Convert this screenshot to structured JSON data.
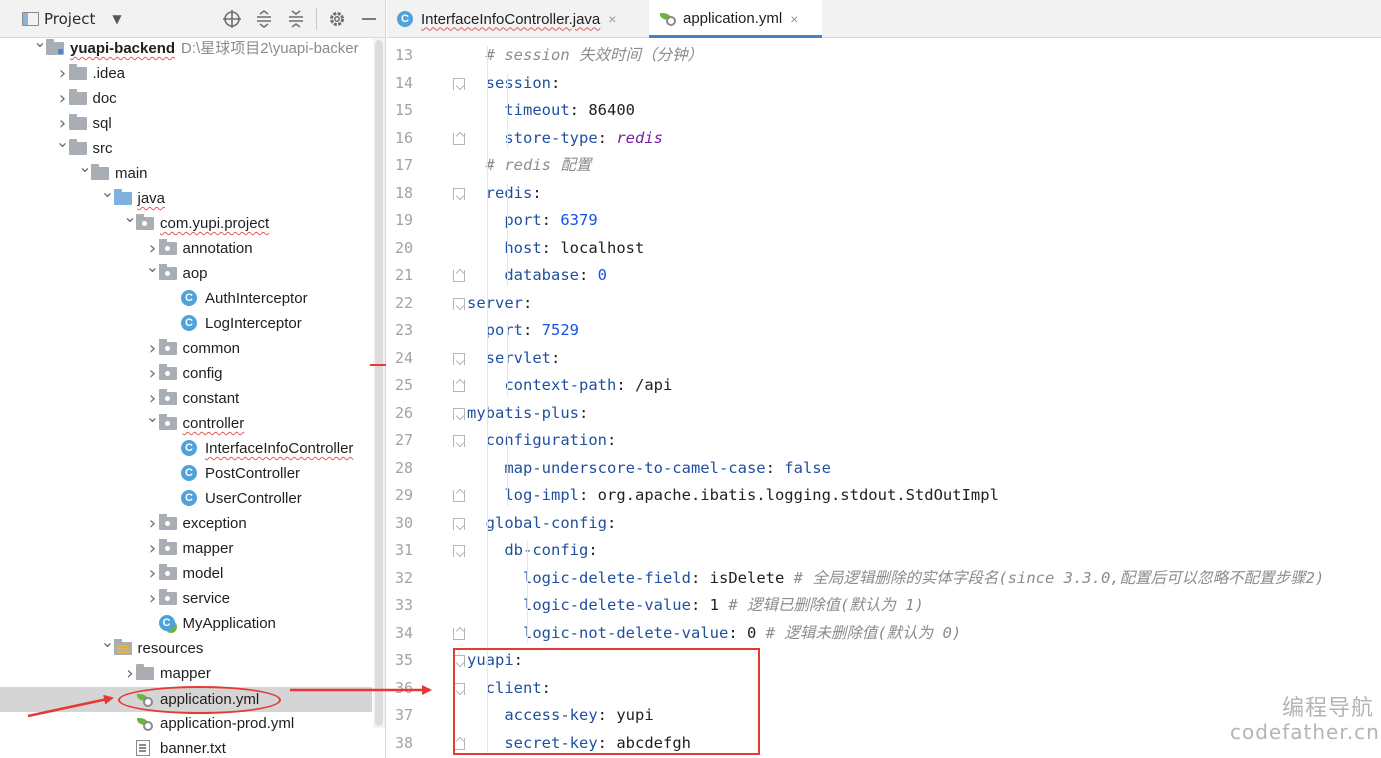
{
  "project_panel": {
    "title": "Project",
    "tree": [
      {
        "label": "yuapi-backend",
        "path": "D:\\星球项目2\\yuapi-backer",
        "icon": "module-folder-icon",
        "arrow": "down",
        "squiggle": true,
        "bold": true
      },
      {
        "label": ".idea",
        "icon": "folder-icon",
        "arrow": "right"
      },
      {
        "label": "doc",
        "icon": "folder-icon",
        "arrow": "right"
      },
      {
        "label": "sql",
        "icon": "folder-icon",
        "arrow": "right"
      },
      {
        "label": "src",
        "icon": "folder-icon",
        "arrow": "down"
      },
      {
        "label": "main",
        "icon": "folder-icon",
        "arrow": "down"
      },
      {
        "label": "java",
        "icon": "source-folder-icon",
        "arrow": "down",
        "squiggle": true
      },
      {
        "label": "com.yupi.project",
        "icon": "package-icon",
        "arrow": "down",
        "squiggle": true
      },
      {
        "label": "annotation",
        "icon": "package-icon",
        "arrow": "right"
      },
      {
        "label": "aop",
        "icon": "package-icon",
        "arrow": "down"
      },
      {
        "label": "AuthInterceptor",
        "icon": "class-icon",
        "arrow": ""
      },
      {
        "label": "LogInterceptor",
        "icon": "class-icon",
        "arrow": ""
      },
      {
        "label": "common",
        "icon": "package-icon",
        "arrow": "right"
      },
      {
        "label": "config",
        "icon": "package-icon",
        "arrow": "right"
      },
      {
        "label": "constant",
        "icon": "package-icon",
        "arrow": "right"
      },
      {
        "label": "controller",
        "icon": "package-icon",
        "arrow": "down",
        "squiggle": true
      },
      {
        "label": "InterfaceInfoController",
        "icon": "class-icon",
        "arrow": "",
        "squiggle": true
      },
      {
        "label": "PostController",
        "icon": "class-icon",
        "arrow": ""
      },
      {
        "label": "UserController",
        "icon": "class-icon",
        "arrow": ""
      },
      {
        "label": "exception",
        "icon": "package-icon",
        "arrow": "right"
      },
      {
        "label": "mapper",
        "icon": "package-icon",
        "arrow": "right"
      },
      {
        "label": "model",
        "icon": "package-icon",
        "arrow": "right"
      },
      {
        "label": "service",
        "icon": "package-icon",
        "arrow": "right"
      },
      {
        "label": "MyApplication",
        "icon": "spring-app-icon",
        "arrow": ""
      },
      {
        "label": "resources",
        "icon": "resources-folder-icon",
        "arrow": "down"
      },
      {
        "label": "mapper",
        "icon": "folder-icon",
        "arrow": "right"
      },
      {
        "label": "application.yml",
        "icon": "spring-yaml-icon",
        "arrow": "",
        "selected": true
      },
      {
        "label": "application-prod.yml",
        "icon": "spring-yaml-icon",
        "arrow": ""
      },
      {
        "label": "banner.txt",
        "icon": "text-file-icon",
        "arrow": ""
      }
    ]
  },
  "editor": {
    "tabs": [
      {
        "label": "InterfaceInfoController.java",
        "icon": "class-icon",
        "active": false,
        "close": "×"
      },
      {
        "label": "application.yml",
        "icon": "spring-yaml-icon",
        "active": true,
        "close": "×"
      }
    ],
    "lines": [
      {
        "no": "13",
        "fold": "",
        "tokens": [
          {
            "t": "  "
          },
          {
            "t": "# session 失效时间（分钟）",
            "c": "comment"
          }
        ]
      },
      {
        "no": "14",
        "fold": "open",
        "tokens": [
          {
            "t": "  "
          },
          {
            "t": "session",
            "c": "key"
          },
          {
            "t": ":"
          }
        ]
      },
      {
        "no": "15",
        "fold": "",
        "tokens": [
          {
            "t": "    "
          },
          {
            "t": "timeout",
            "c": "key"
          },
          {
            "t": ": "
          },
          {
            "t": "86400",
            "c": "str"
          }
        ]
      },
      {
        "no": "16",
        "fold": "close",
        "tokens": [
          {
            "t": "    "
          },
          {
            "t": "store-type",
            "c": "key"
          },
          {
            "t": ": "
          },
          {
            "t": "redis",
            "c": "italic"
          }
        ]
      },
      {
        "no": "17",
        "fold": "",
        "tokens": [
          {
            "t": "  "
          },
          {
            "t": "# redis 配置",
            "c": "comment"
          }
        ]
      },
      {
        "no": "18",
        "fold": "open",
        "tokens": [
          {
            "t": "  "
          },
          {
            "t": "redis",
            "c": "key"
          },
          {
            "t": ":"
          }
        ]
      },
      {
        "no": "19",
        "fold": "",
        "tokens": [
          {
            "t": "    "
          },
          {
            "t": "port",
            "c": "key"
          },
          {
            "t": ": "
          },
          {
            "t": "6379",
            "c": "num"
          }
        ]
      },
      {
        "no": "20",
        "fold": "",
        "tokens": [
          {
            "t": "    "
          },
          {
            "t": "host",
            "c": "key"
          },
          {
            "t": ": "
          },
          {
            "t": "localhost",
            "c": "str"
          }
        ]
      },
      {
        "no": "21",
        "fold": "close",
        "tokens": [
          {
            "t": "    "
          },
          {
            "t": "database",
            "c": "key"
          },
          {
            "t": ": "
          },
          {
            "t": "0",
            "c": "num"
          }
        ]
      },
      {
        "no": "22",
        "fold": "open",
        "tokens": [
          {
            "t": "server",
            "c": "key"
          },
          {
            "t": ":"
          }
        ]
      },
      {
        "no": "23",
        "fold": "",
        "tokens": [
          {
            "t": "  "
          },
          {
            "t": "port",
            "c": "key"
          },
          {
            "t": ": "
          },
          {
            "t": "7529",
            "c": "num"
          }
        ]
      },
      {
        "no": "24",
        "fold": "open",
        "tokens": [
          {
            "t": "  "
          },
          {
            "t": "servlet",
            "c": "key"
          },
          {
            "t": ":"
          }
        ]
      },
      {
        "no": "25",
        "fold": "close",
        "tokens": [
          {
            "t": "    "
          },
          {
            "t": "context-path",
            "c": "key"
          },
          {
            "t": ": "
          },
          {
            "t": "/api",
            "c": "str"
          }
        ]
      },
      {
        "no": "26",
        "fold": "open",
        "tokens": [
          {
            "t": "mybatis-plus",
            "c": "key"
          },
          {
            "t": ":"
          }
        ]
      },
      {
        "no": "27",
        "fold": "open",
        "tokens": [
          {
            "t": "  "
          },
          {
            "t": "configuration",
            "c": "key"
          },
          {
            "t": ":"
          }
        ]
      },
      {
        "no": "28",
        "fold": "",
        "tokens": [
          {
            "t": "    "
          },
          {
            "t": "map-underscore-to-camel-case",
            "c": "key"
          },
          {
            "t": ": "
          },
          {
            "t": "false",
            "c": "kw"
          }
        ]
      },
      {
        "no": "29",
        "fold": "close",
        "tokens": [
          {
            "t": "    "
          },
          {
            "t": "log-impl",
            "c": "key"
          },
          {
            "t": ": "
          },
          {
            "t": "org.apache.ibatis.logging.stdout.StdOutImpl",
            "c": "str"
          }
        ]
      },
      {
        "no": "30",
        "fold": "open",
        "tokens": [
          {
            "t": "  "
          },
          {
            "t": "global-config",
            "c": "key"
          },
          {
            "t": ":"
          }
        ]
      },
      {
        "no": "31",
        "fold": "open",
        "tokens": [
          {
            "t": "    "
          },
          {
            "t": "db-config",
            "c": "key"
          },
          {
            "t": ":"
          }
        ]
      },
      {
        "no": "32",
        "fold": "",
        "tokens": [
          {
            "t": "      "
          },
          {
            "t": "logic-delete-field",
            "c": "key"
          },
          {
            "t": ": "
          },
          {
            "t": "isDelete",
            "c": "str"
          },
          {
            "t": " "
          },
          {
            "t": "# 全局逻辑删除的实体字段名(since 3.3.0,配置后可以忽略不配置步骤2)",
            "c": "comment"
          }
        ]
      },
      {
        "no": "33",
        "fold": "",
        "tokens": [
          {
            "t": "      "
          },
          {
            "t": "logic-delete-value",
            "c": "key"
          },
          {
            "t": ": "
          },
          {
            "t": "1",
            "c": "str"
          },
          {
            "t": " "
          },
          {
            "t": "# 逻辑已删除值(默认为 1)",
            "c": "comment"
          }
        ]
      },
      {
        "no": "34",
        "fold": "close",
        "tokens": [
          {
            "t": "      "
          },
          {
            "t": "logic-not-delete-value",
            "c": "key"
          },
          {
            "t": ": "
          },
          {
            "t": "0",
            "c": "str"
          },
          {
            "t": " "
          },
          {
            "t": "# 逻辑未删除值(默认为 0)",
            "c": "comment"
          }
        ]
      },
      {
        "no": "35",
        "fold": "open",
        "tokens": [
          {
            "t": "yuapi",
            "c": "key"
          },
          {
            "t": ":"
          }
        ]
      },
      {
        "no": "36",
        "fold": "open",
        "tokens": [
          {
            "t": "  "
          },
          {
            "t": "client",
            "c": "key"
          },
          {
            "t": ":"
          }
        ]
      },
      {
        "no": "37",
        "fold": "",
        "tokens": [
          {
            "t": "    "
          },
          {
            "t": "access-key",
            "c": "key"
          },
          {
            "t": ": "
          },
          {
            "t": "yupi",
            "c": "str"
          }
        ]
      },
      {
        "no": "38",
        "fold": "close",
        "tokens": [
          {
            "t": "    "
          },
          {
            "t": "secret-key",
            "c": "key"
          },
          {
            "t": ": "
          },
          {
            "t": "abcdefgh",
            "c": "str"
          }
        ]
      }
    ]
  },
  "watermark": {
    "line1": "编程导航",
    "line2": "codefather.cn"
  },
  "colors": {
    "annotation_red": "#e53935",
    "accent_blue": "#4083c9",
    "yaml_key": "#1f4f9e",
    "yaml_number": "#1750eb",
    "comment": "#8c8c8c"
  }
}
